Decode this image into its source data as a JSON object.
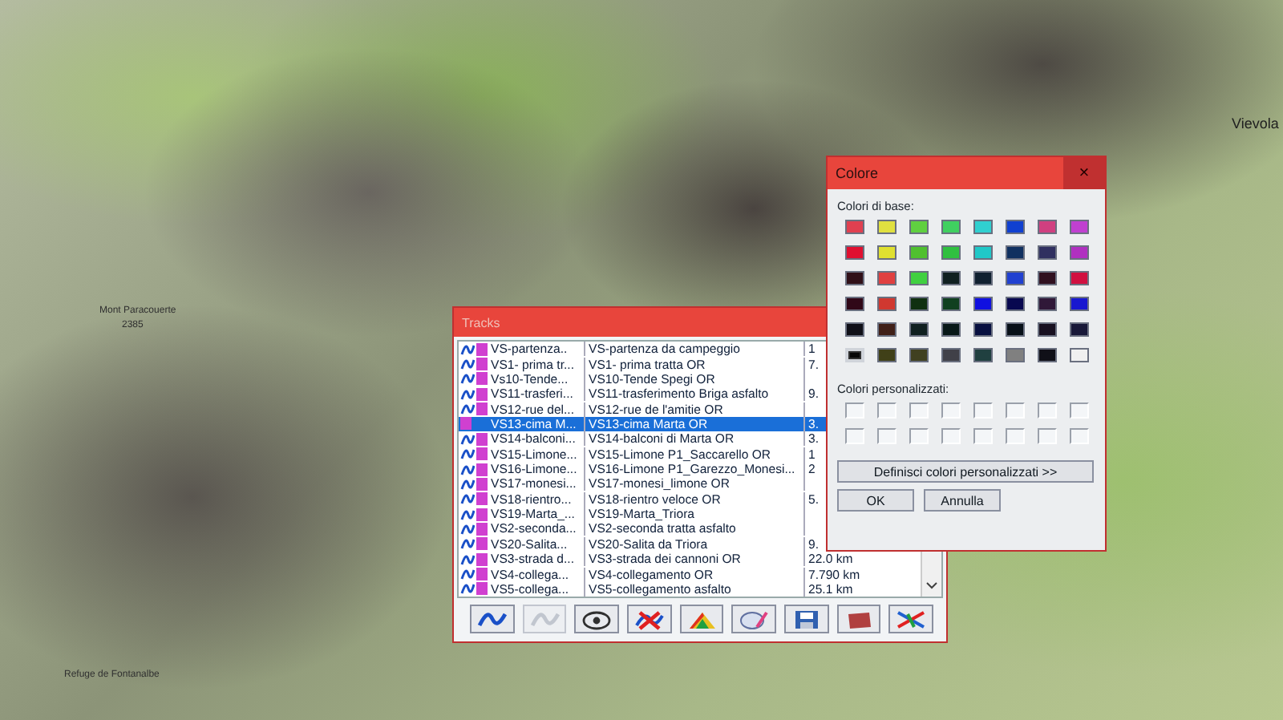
{
  "map": {
    "labels": [
      "Mont Paracouerte",
      "2385",
      "Refuge de Fontanalbe",
      "Vievola"
    ]
  },
  "tracks": {
    "title": "Tracks",
    "rows": [
      {
        "short": "VS-partenza..",
        "name": "VS-partenza da campeggio",
        "distance": "1",
        "color": "#d040d0",
        "selected": false
      },
      {
        "short": "VS1- prima tr...",
        "name": "VS1- prima tratta OR",
        "distance": "7.",
        "color": "#d040d0",
        "selected": false
      },
      {
        "short": "Vs10-Tende...",
        "name": "VS10-Tende Spegi OR",
        "color": "#d040d0",
        "selected": false
      },
      {
        "short": "VS11-trasferi...",
        "name": "VS11-trasferimento Briga asfalto",
        "distance": "9.",
        "color": "#d040d0",
        "selected": false
      },
      {
        "short": "VS12-rue del...",
        "name": "VS12-rue de l'amitie OR",
        "color": "#d040d0",
        "selected": false
      },
      {
        "short": "VS13-cima M...",
        "name": "VS13-cima Marta OR",
        "distance": "3.",
        "color": "#d040d0",
        "selected": true
      },
      {
        "short": "VS14-balconi...",
        "name": "VS14-balconi di Marta OR",
        "distance": "3.",
        "color": "#d040d0",
        "selected": false
      },
      {
        "short": "VS15-Limone...",
        "name": "VS15-Limone P1_Saccarello OR",
        "distance": "1",
        "color": "#d040d0",
        "selected": false
      },
      {
        "short": "VS16-Limone...",
        "name": "VS16-Limone  P1_Garezzo_Monesi...",
        "distance": "2",
        "color": "#d040d0",
        "selected": false
      },
      {
        "short": "VS17-monesi...",
        "name": "VS17-monesi_limone OR",
        "color": "#d040d0",
        "selected": false
      },
      {
        "short": "VS18-rientro...",
        "name": "VS18-rientro veloce OR",
        "distance": "5.",
        "color": "#d040d0",
        "selected": false
      },
      {
        "short": "VS19-Marta_...",
        "name": "VS19-Marta_Triora",
        "color": "#d040d0",
        "selected": false
      },
      {
        "short": "VS2-seconda...",
        "name": "VS2-seconda tratta asfalto",
        "color": "#d040d0",
        "selected": false
      },
      {
        "short": "VS20-Salita...",
        "name": "VS20-Salita da Triora",
        "distance": "9.",
        "color": "#d040d0",
        "selected": false
      },
      {
        "short": "VS3-strada d...",
        "name": "VS3-strada dei cannoni OR",
        "distance": "22.0 km",
        "color": "#d040d0",
        "selected": false
      },
      {
        "short": "VS4-collega...",
        "name": "VS4-collegamento OR",
        "distance": "7.790 km",
        "color": "#d040d0",
        "selected": false
      },
      {
        "short": "VS5-collega...",
        "name": "VS5-collegamento asfalto",
        "distance": "25.1 km",
        "color": "#d040d0",
        "selected": false
      }
    ],
    "toolbar": [
      {
        "disabled": false
      },
      {
        "disabled": true
      },
      {
        "disabled": false
      },
      {
        "disabled": false
      },
      {
        "disabled": false
      },
      {
        "disabled": false
      },
      {
        "disabled": false
      },
      {
        "disabled": false
      },
      {
        "disabled": false
      }
    ]
  },
  "color_dialog": {
    "title": "Colore",
    "close": "×",
    "basic_label": "Colori di base:",
    "basic_colors": [
      {
        "color": "#e04050",
        "selected": false
      },
      {
        "color": "#e0e040",
        "selected": false
      },
      {
        "color": "#60d040",
        "selected": false
      },
      {
        "color": "#40d060",
        "selected": false
      },
      {
        "color": "#30d0d0",
        "selected": false
      },
      {
        "color": "#1040d0",
        "selected": false
      },
      {
        "color": "#d04080",
        "selected": false
      },
      {
        "color": "#c040d0",
        "selected": false
      },
      {
        "color": "#e01030",
        "selected": false
      },
      {
        "color": "#e0e030",
        "selected": false
      },
      {
        "color": "#50c030",
        "selected": false
      },
      {
        "color": "#30c040",
        "selected": false
      },
      {
        "color": "#20c8c8",
        "selected": false
      },
      {
        "color": "#103060",
        "selected": false
      },
      {
        "color": "#303060",
        "selected": false
      },
      {
        "color": "#b030c0",
        "selected": false
      },
      {
        "color": "#301018",
        "selected": false
      },
      {
        "color": "#e04040",
        "selected": false
      },
      {
        "color": "#40d040",
        "selected": false
      },
      {
        "color": "#102020",
        "selected": false
      },
      {
        "color": "#102030",
        "selected": false
      },
      {
        "color": "#2040d0",
        "selected": false
      },
      {
        "color": "#301020",
        "selected": false
      },
      {
        "color": "#d01040",
        "selected": false
      },
      {
        "color": "#300818",
        "selected": false
      },
      {
        "color": "#d03830",
        "selected": false
      },
      {
        "color": "#103010",
        "selected": false
      },
      {
        "color": "#104020",
        "selected": false
      },
      {
        "color": "#1010e0",
        "selected": false
      },
      {
        "color": "#080850",
        "selected": false
      },
      {
        "color": "#301838",
        "selected": false
      },
      {
        "color": "#1818d0",
        "selected": false
      },
      {
        "color": "#101018",
        "selected": false
      },
      {
        "color": "#402018",
        "selected": false
      },
      {
        "color": "#102020",
        "selected": false
      },
      {
        "color": "#081818",
        "selected": false
      },
      {
        "color": "#081040",
        "selected": false
      },
      {
        "color": "#081018",
        "selected": false
      },
      {
        "color": "#181020",
        "selected": false
      },
      {
        "color": "#181838",
        "selected": false
      },
      {
        "color": "#080808",
        "selected": true
      },
      {
        "color": "#404018",
        "selected": false
      },
      {
        "color": "#404020",
        "selected": false
      },
      {
        "color": "#404048",
        "selected": false
      },
      {
        "color": "#204040",
        "selected": false
      },
      {
        "color": "#808080",
        "selected": false
      },
      {
        "color": "#101018",
        "selected": false
      },
      {
        "color": "#f0f0f0",
        "selected": false
      }
    ],
    "custom_label": "Colori personalizzati:",
    "define_button": "Definisci colori personalizzati >>",
    "buttons": [
      "OK",
      "Annulla"
    ]
  }
}
